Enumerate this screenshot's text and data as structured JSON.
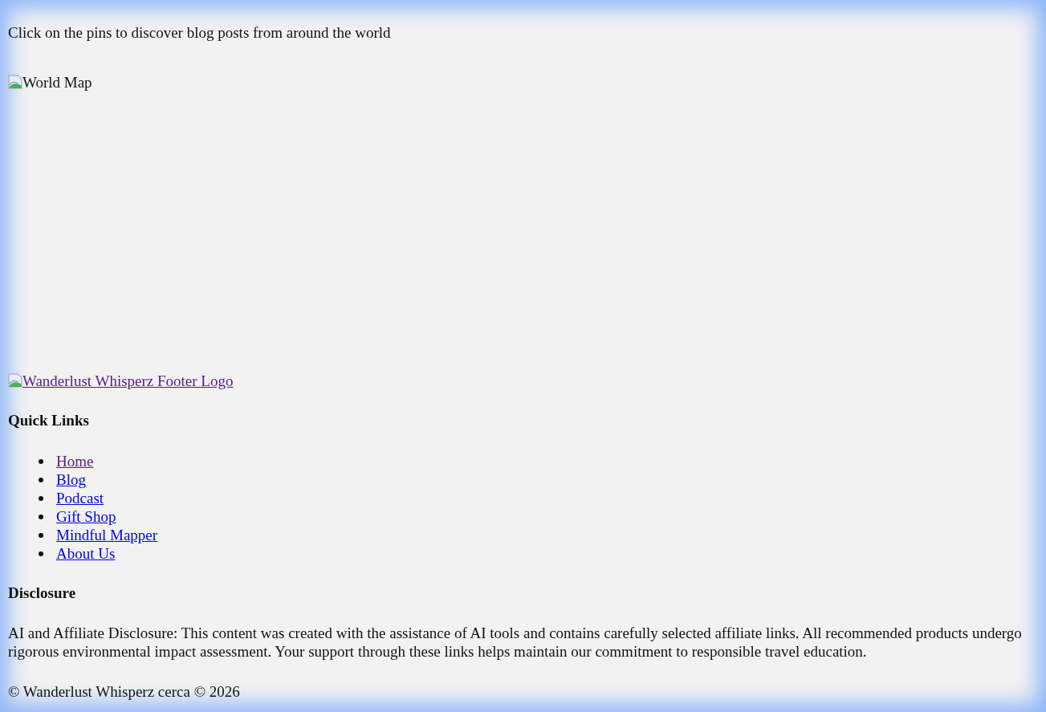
{
  "intro": "Click on the pins to discover blog posts from around the world",
  "map_image": {
    "alt": "World Map"
  },
  "footer_logo": {
    "alt": "Wanderlust Whisperz Footer Logo",
    "visited": true
  },
  "quick_links": {
    "title": "Quick Links",
    "links": [
      {
        "label": "Home",
        "visited": true
      },
      {
        "label": "Blog",
        "visited": false
      },
      {
        "label": "Podcast",
        "visited": false
      },
      {
        "label": "Gift Shop",
        "visited": false
      },
      {
        "label": "Mindful Mapper",
        "visited": false
      },
      {
        "label": "About Us",
        "visited": false
      }
    ]
  },
  "disclosure": {
    "title": "Disclosure",
    "text": "AI and Affiliate Disclosure: This content was created with the assistance of AI tools and contains carefully selected affiliate links. All recommended products undergo rigorous environmental impact assessment. Your support through these links helps maintain our commitment to responsible travel education."
  },
  "copyright": "© Wanderlust Whisperz cerca © 2026"
}
